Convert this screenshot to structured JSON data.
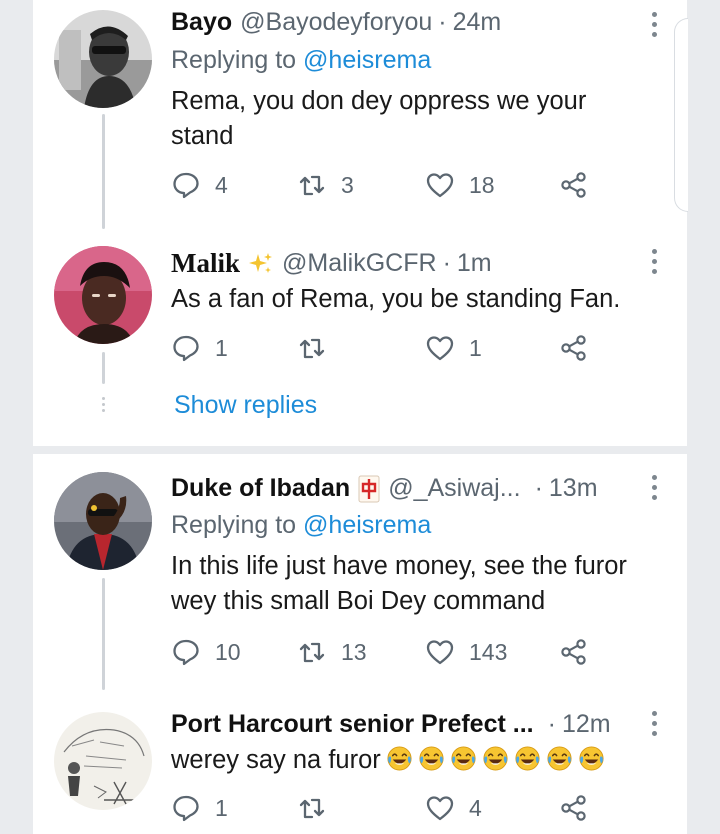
{
  "tweets": [
    {
      "name": "Bayo",
      "handle": "@Bayodeyforyou",
      "sep": "·",
      "time": "24m",
      "replying_prefix": "Replying to",
      "replying_to": "@heisrema",
      "text": "Rema, you don dey oppress we your stand",
      "replies": "4",
      "retweets": "3",
      "likes": "18",
      "avatar_icon": "person-with-sunglasses-avatar"
    },
    {
      "name": "Malik",
      "handle": "@MalikGCFR",
      "sep": "·",
      "time": "1m",
      "text": "As a fan of Rema, you be standing Fan.",
      "replies": "1",
      "retweets": "",
      "likes": "1",
      "name_badge_icon": "sparkles-icon",
      "avatar_icon": "person-avatar"
    },
    {
      "name": "Duke of Ibadan",
      "handle": "@_Asiwaj...",
      "sep": "·",
      "time": "13m",
      "replying_prefix": "Replying to",
      "replying_to": "@heisrema",
      "text": "In this life just have money, see the furor wey this small Boi Dey command",
      "replies": "10",
      "retweets": "13",
      "likes": "143",
      "name_badge_icon": "mahjong-red-dragon-icon",
      "avatar_icon": "person-in-agbada-avatar"
    },
    {
      "name": "Port Harcourt senior Prefect ...",
      "handle": "",
      "sep": "·",
      "time": "12m",
      "text": "werey say na furor",
      "replies": "1",
      "retweets": "",
      "likes": "4",
      "emoji_icon": "face-with-tears-of-joy-icon",
      "emoji_count": 7,
      "avatar_icon": "sketch-drawing-avatar"
    }
  ],
  "show_replies_label": "Show replies",
  "colors": {
    "link": "#1d8cd8",
    "secondary_text": "#5b6670",
    "divider": "#e9ebee"
  }
}
